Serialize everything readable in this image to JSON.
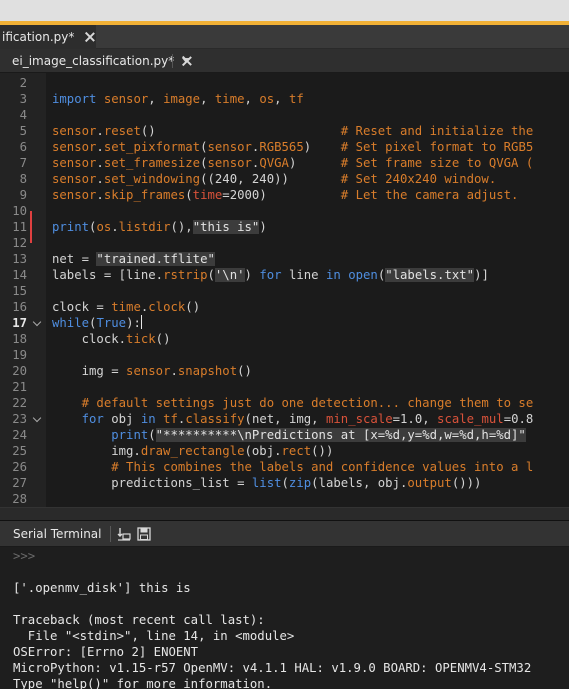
{
  "outer_tab": {
    "label": "ification.py*"
  },
  "file_selector": {
    "label": "ei_image_classification.py*"
  },
  "editor": {
    "current_line": 17,
    "lines": [
      {
        "n": "2",
        "text": ""
      },
      {
        "n": "3",
        "text": "import sensor, image, time, os, tf"
      },
      {
        "n": "4",
        "text": ""
      },
      {
        "n": "5",
        "text": "sensor.reset()                         # Reset and initialize the"
      },
      {
        "n": "6",
        "text": "sensor.set_pixformat(sensor.RGB565)    # Set pixel format to RGB5"
      },
      {
        "n": "7",
        "text": "sensor.set_framesize(sensor.QVGA)      # Set frame size to QVGA ("
      },
      {
        "n": "8",
        "text": "sensor.set_windowing((240, 240))       # Set 240x240 window."
      },
      {
        "n": "9",
        "text": "sensor.skip_frames(time=2000)          # Let the camera adjust."
      },
      {
        "n": "10",
        "text": ""
      },
      {
        "n": "11",
        "text": "print(os.listdir(),\"this is\")"
      },
      {
        "n": "12",
        "text": ""
      },
      {
        "n": "13",
        "text": "net = \"trained.tflite\""
      },
      {
        "n": "14",
        "text": "labels = [line.rstrip('\\n') for line in open(\"labels.txt\")]"
      },
      {
        "n": "15",
        "text": ""
      },
      {
        "n": "16",
        "text": "clock = time.clock()"
      },
      {
        "n": "17",
        "text": "while(True):"
      },
      {
        "n": "18",
        "text": "    clock.tick()"
      },
      {
        "n": "19",
        "text": ""
      },
      {
        "n": "20",
        "text": "    img = sensor.snapshot()"
      },
      {
        "n": "21",
        "text": ""
      },
      {
        "n": "22",
        "text": "    # default settings just do one detection... change them to se"
      },
      {
        "n": "23",
        "text": "    for obj in tf.classify(net, img, min_scale=1.0, scale_mul=0.8"
      },
      {
        "n": "24",
        "text": "        print(\"**********\\nPredictions at [x=%d,y=%d,w=%d,h=%d]\" "
      },
      {
        "n": "25",
        "text": "        img.draw_rectangle(obj.rect())"
      },
      {
        "n": "26",
        "text": "        # This combines the labels and confidence values into a l"
      },
      {
        "n": "27",
        "text": "        predictions_list = list(zip(labels, obj.output()))"
      },
      {
        "n": "28",
        "text": ""
      }
    ]
  },
  "terminal": {
    "title": "Serial Terminal",
    "lines": [
      ">>>",
      "",
      "['.openmv_disk'] this is",
      "",
      "Traceback (most recent call last):",
      "  File \"<stdin>\", line 14, in <module>",
      "OSError: [Errno 2] ENOENT",
      "MicroPython: v1.15-r57 OpenMV: v4.1.1 HAL: v1.9.0 BOARD: OPENMV4-STM32",
      "Type \"help()\" for more information."
    ]
  },
  "colors": {
    "accent": "#f2b136",
    "keyword": "#4f8ee0",
    "function": "#d97d2b",
    "comment": "#d97d2b",
    "kwarg": "#d9523a",
    "modified_marker": "#e04040"
  },
  "icons": [
    "close-icon",
    "fold-arrow-icon",
    "clear-terminal-icon",
    "save-log-icon"
  ]
}
